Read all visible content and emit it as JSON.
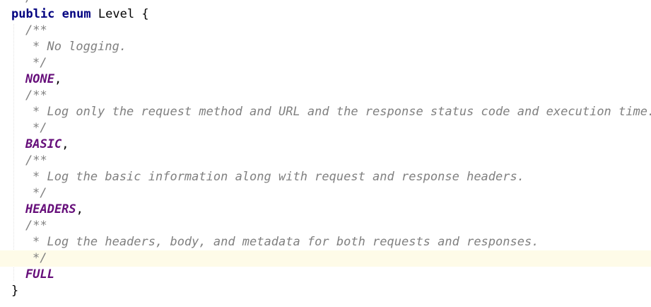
{
  "code": {
    "top_fragment": "/",
    "kw_public": "public",
    "kw_enum": "enum",
    "enum_name": "Level",
    "open_brace": "{",
    "close_brace": "}",
    "doc_open": "/**",
    "doc_close": "*/",
    "comment_none": "* No logging.",
    "comment_basic": "* Log only the request method and URL and the response status code and execution time.",
    "comment_headers": "* Log the basic information along with request and response headers.",
    "comment_full": "* Log the headers, body, and metadata for both requests and responses.",
    "const_none": "NONE",
    "const_basic": "BASIC",
    "const_headers": "HEADERS",
    "const_full": "FULL",
    "comma": ","
  },
  "colors": {
    "keyword": "#000080",
    "doc_comment": "#808080",
    "enum_constant": "#660e7a",
    "current_line": "#fefbe8"
  }
}
